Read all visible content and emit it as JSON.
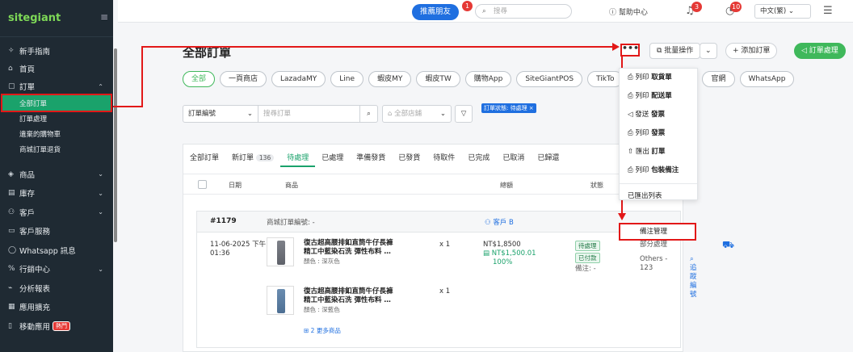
{
  "sidebar": {
    "logo": {
      "text_a": "site",
      "text_b": "giant"
    },
    "items": [
      {
        "icon": "rocket-icon",
        "glyph": "✧",
        "label": "新手指南"
      },
      {
        "icon": "home-icon",
        "glyph": "⌂",
        "label": "首頁"
      },
      {
        "icon": "order-icon",
        "glyph": "▢",
        "label": "訂單",
        "chevron": "⌃"
      }
    ],
    "order_sub": [
      {
        "label": "全部訂單",
        "active": true
      },
      {
        "label": "訂單處理"
      },
      {
        "label": "遺棄的購物車"
      },
      {
        "label": "商城訂單退貨"
      }
    ],
    "items2": [
      {
        "icon": "product-icon",
        "glyph": "◈",
        "label": "商品",
        "chevron": "⌄"
      },
      {
        "icon": "inventory-icon",
        "glyph": "▤",
        "label": "庫存",
        "chevron": "⌄"
      },
      {
        "icon": "customer-icon",
        "glyph": "⚇",
        "label": "客戶",
        "chevron": "⌄"
      },
      {
        "icon": "service-icon",
        "glyph": "▭",
        "label": "客戶服務"
      },
      {
        "icon": "whatsapp-icon",
        "glyph": "◯",
        "label": "Whatsapp 訊息"
      },
      {
        "icon": "marketing-icon",
        "glyph": "%",
        "label": "行銷中心",
        "chevron": "⌄"
      },
      {
        "icon": "report-icon",
        "glyph": "⌁",
        "label": "分析報表"
      },
      {
        "icon": "apps-icon",
        "glyph": "▦",
        "label": "應用擴充"
      },
      {
        "icon": "mobile-icon",
        "glyph": "▯",
        "label": "移動應用",
        "badge": "熱門"
      }
    ]
  },
  "topbar": {
    "refer_label": "推薦朋友",
    "refer_count": "1",
    "search_placeholder": "搜尋",
    "help_label": "幫助中心",
    "bell_count": "3",
    "activity_count": "10",
    "language": "中文(繁)"
  },
  "page": {
    "title": "全部訂單",
    "more_label": "•••",
    "bulk_label": "批量操作",
    "add_label": "+ 添加訂單",
    "process_label": "訂單處理"
  },
  "channels": [
    "全部",
    "一頁商店",
    "LazadaMY",
    "Line",
    "蝦皮MY",
    "蝦皮TW",
    "購物App",
    "SiteGiantPOS",
    "TikTo",
    "官網",
    "WhatsApp"
  ],
  "filters": {
    "field": "訂單編號",
    "search_placeholder": "搜尋訂單",
    "store_placeholder": "全部店鋪",
    "active_tag": "訂單狀態: 待處理 ×"
  },
  "status_tabs": [
    {
      "label": "全部訂單"
    },
    {
      "label": "新訂單",
      "count": "136"
    },
    {
      "label": "待處理",
      "active": true
    },
    {
      "label": "已處理"
    },
    {
      "label": "準備發貨"
    },
    {
      "label": "已發貨"
    },
    {
      "label": "待取件"
    },
    {
      "label": "已完成"
    },
    {
      "label": "已取消"
    },
    {
      "label": "已歸還"
    }
  ],
  "columns": {
    "date": "日期",
    "product": "商品",
    "total": "總額",
    "status": "狀態"
  },
  "order": {
    "number": "#1179",
    "platform_label": "商城訂單編號: -",
    "customer": "客戶 B",
    "date": "11-06-2025 下午",
    "time": "01:36",
    "products": [
      {
        "name1": "復古超高腰排釦直筒牛仔長褲",
        "name2": "精工中藍染石洗 彈性布料 …",
        "attr": "顏色 : 深灰色",
        "qty": "x 1"
      },
      {
        "name1": "復古超高腰排釦直筒牛仔長褲",
        "name2": "精工中藍染石洗 彈性布料 …",
        "attr": "顏色 : 深藍色",
        "qty": "x 1"
      }
    ],
    "more_products": "2 更多商品",
    "total": "NT$1,8500",
    "paid": "NT$1,500.01",
    "paid_pct": "100%",
    "status_tag": "待處理",
    "paid_tag": "已付款",
    "note": "備注: -",
    "ship_tag": "部分處理",
    "courier": "Others - 123",
    "tracking": "追蹤編號"
  },
  "dropdown": [
    {
      "icon": "print-icon",
      "glyph": "⎙",
      "a": "列印 ",
      "b": "取貨單"
    },
    {
      "icon": "print-icon",
      "glyph": "⎙",
      "a": "列印 ",
      "b": "配送單"
    },
    {
      "icon": "send-icon",
      "glyph": "◁",
      "a": "發送 ",
      "b": "發票"
    },
    {
      "icon": "print-icon",
      "glyph": "⎙",
      "a": "列印 ",
      "b": "發票"
    },
    {
      "icon": "export-icon",
      "glyph": "⇧",
      "a": "匯出 ",
      "b": "訂單"
    },
    {
      "icon": "print-icon",
      "glyph": "⎙",
      "a": "列印 ",
      "b": "包裝備注"
    }
  ],
  "dropdown_exported": "已匯出列表",
  "dropdown_highlight": "備注管理",
  "colors": {
    "accent": "#1aa26b",
    "annotation": "#e21818",
    "brand_blue": "#1f6fe0"
  }
}
